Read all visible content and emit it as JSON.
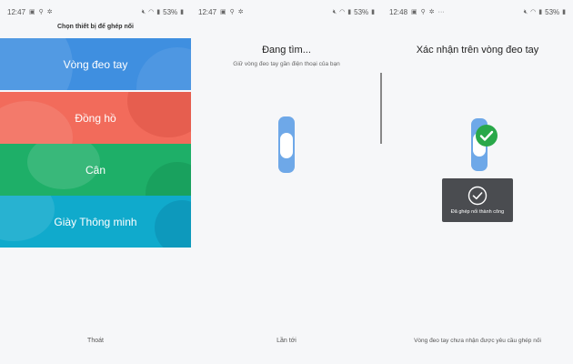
{
  "screens": [
    {
      "status": {
        "time": "12:47",
        "battery": "53%"
      },
      "title": "Chọn thiết bị để ghép nối",
      "devices": [
        {
          "label": "Vòng đeo tay",
          "color": "#3f8fe0"
        },
        {
          "label": "Đồng hồ",
          "color": "#f26b5b"
        },
        {
          "label": "Cân",
          "color": "#1eaf68"
        },
        {
          "label": "Giày Thông minh",
          "color": "#10aacc"
        }
      ],
      "bottom": "Thoát"
    },
    {
      "status": {
        "time": "12:47",
        "battery": "53%"
      },
      "title": "Đang tìm...",
      "subtitle": "Giữ vòng đeo tay gần điện thoại của bạn",
      "bottom": "Lần tới"
    },
    {
      "status": {
        "time": "12:48",
        "battery": "53%"
      },
      "title": "Xác nhận trên vòng đeo tay",
      "toast": "Đã ghép nối thành công",
      "bottom": "Vòng đeo tay chưa nhận được yêu cầu ghép nối"
    }
  ],
  "icons": {
    "status_left": [
      "image-icon",
      "usb-icon",
      "settings-icon"
    ],
    "status_right": [
      "mute-icon",
      "wifi-icon",
      "signal-icon",
      "battery-icon"
    ],
    "band": "band-icon",
    "check": "check-badge-icon"
  },
  "colors": {
    "band_blue": "#6ea8e8",
    "check_green": "#2aa84a",
    "toast_bg": "#4a4c50"
  }
}
